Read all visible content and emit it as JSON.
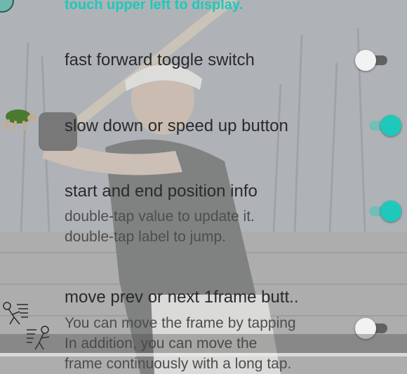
{
  "header": {
    "text": "touch upper left to display."
  },
  "settings": [
    {
      "label": "fast forward toggle switch",
      "description": [],
      "toggle": "off"
    },
    {
      "label": "slow down or speed up button",
      "description": [],
      "toggle": "on"
    },
    {
      "label": "start and end position info",
      "description": [
        "double-tap value to update it.",
        "double-tap label to jump."
      ],
      "toggle": "on"
    },
    {
      "label": "move prev or next 1frame butt..",
      "description": [
        "You can move the frame by tapping",
        "In addition, you can move the",
        "frame continuously with a long tap."
      ],
      "toggle": "off"
    }
  ],
  "colors": {
    "accent": "#1ec9bb",
    "label": "#2a2a2a",
    "description": "#4d4d4d"
  },
  "icons": [
    "turtle-icon",
    "rewind-pitcher-icon",
    "forward-batter-icon"
  ]
}
